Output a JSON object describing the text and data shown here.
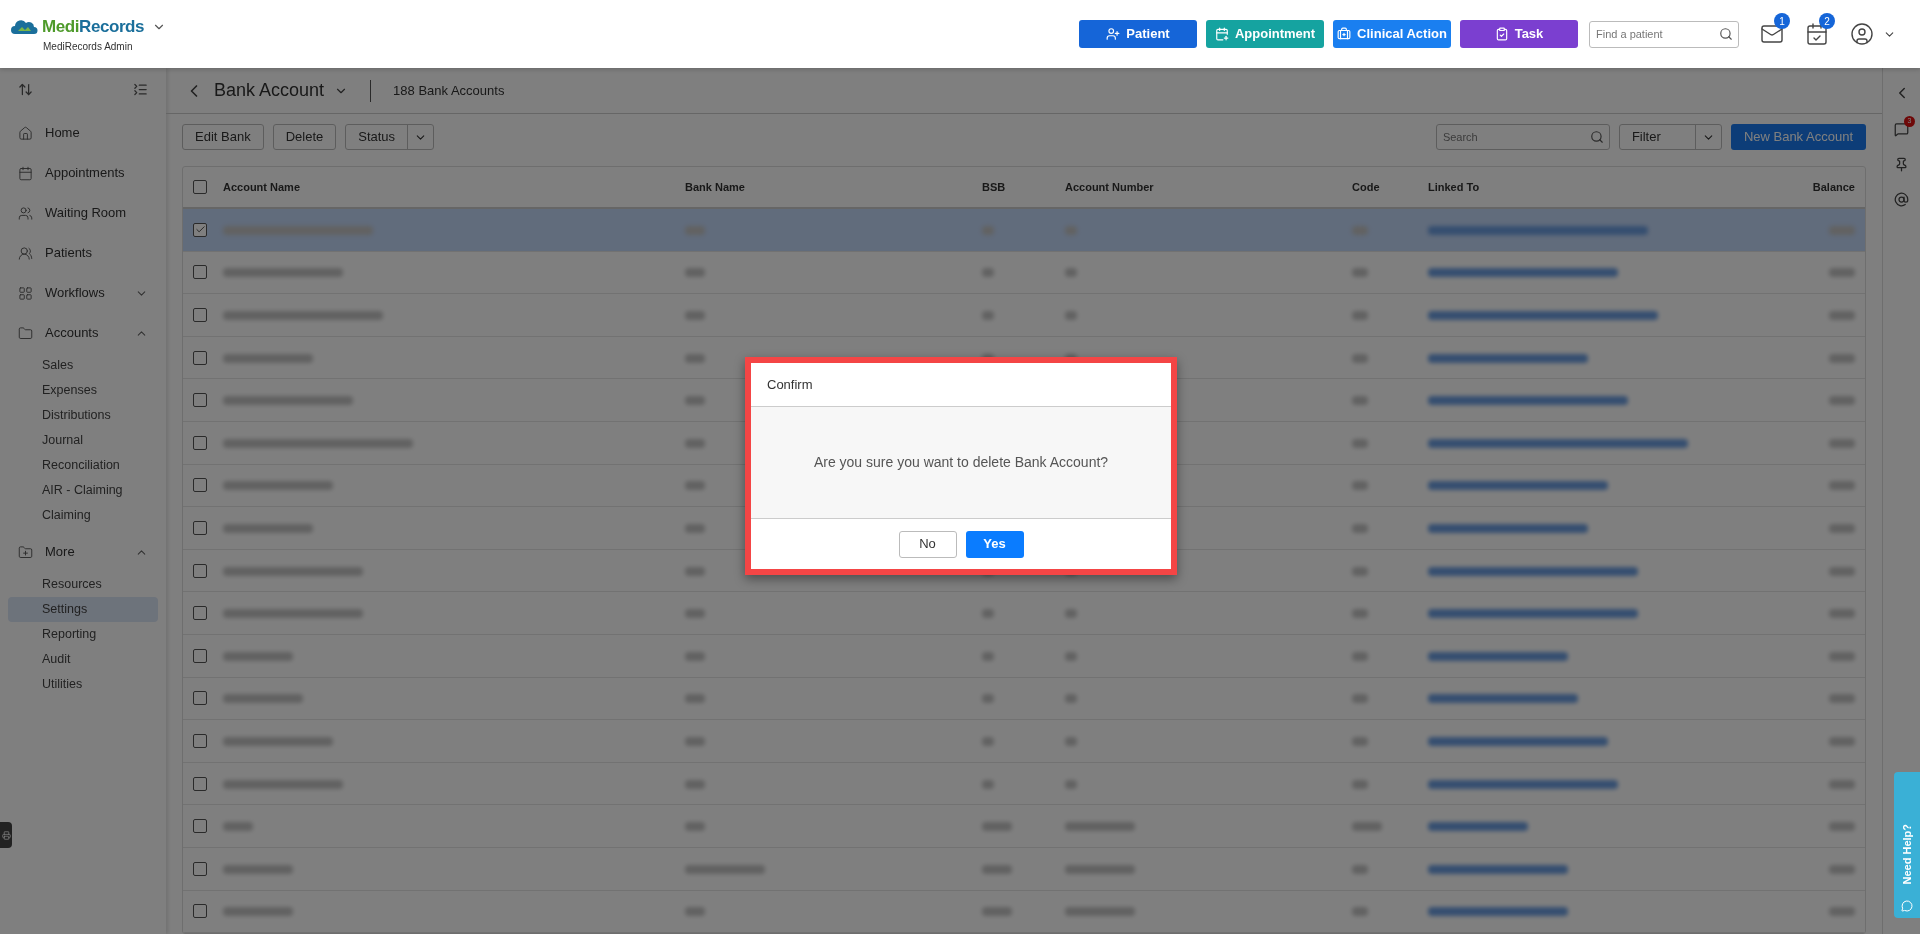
{
  "brand": {
    "name_part_1": "Medi",
    "name_part_2": "Records",
    "subtitle": "MediRecords Admin"
  },
  "top_actions": [
    {
      "label": "Patient",
      "color": "#1565d8"
    },
    {
      "label": "Appointment",
      "color": "#15a3a0"
    },
    {
      "label": "Clinical Action",
      "color": "#1a7ff0"
    },
    {
      "label": "Task",
      "color": "#7b3fd0"
    }
  ],
  "patient_search": {
    "placeholder": "Find a patient"
  },
  "notifications": {
    "mail_count": "1",
    "calendar_count": "2"
  },
  "sidebar": {
    "items": [
      {
        "label": "Home",
        "selected": false
      },
      {
        "label": "Appointments",
        "selected": false
      },
      {
        "label": "Waiting Room",
        "selected": false
      },
      {
        "label": "Patients",
        "selected": false
      },
      {
        "label": "Workflows",
        "selected": false,
        "expanded": false
      },
      {
        "label": "Accounts",
        "selected": false,
        "expanded": true,
        "children": [
          {
            "label": "Sales",
            "selected": false
          },
          {
            "label": "Expenses",
            "selected": false
          },
          {
            "label": "Distributions",
            "selected": false
          },
          {
            "label": "Journal",
            "selected": false
          },
          {
            "label": "Reconciliation",
            "selected": false
          },
          {
            "label": "AIR - Claiming",
            "selected": false
          },
          {
            "label": "Claiming",
            "selected": false
          }
        ]
      },
      {
        "label": "More",
        "selected": false,
        "expanded": true,
        "children": [
          {
            "label": "Resources",
            "selected": false
          },
          {
            "label": "Settings",
            "selected": true
          },
          {
            "label": "Reporting",
            "selected": false
          },
          {
            "label": "Audit",
            "selected": false
          },
          {
            "label": "Utilities",
            "selected": false
          }
        ]
      }
    ]
  },
  "page": {
    "title": "Bank Account",
    "count": "188 Bank Accounts"
  },
  "toolbar": {
    "buttons": [
      "Edit Bank",
      "Delete"
    ],
    "status_label": "Status",
    "search_placeholder": "Search",
    "filter_label": "Filter",
    "new_button": "New Bank Account"
  },
  "table": {
    "all_selected": false,
    "columns": [
      "Account Name",
      "Bank Name",
      "BSB",
      "Account Number",
      "Code",
      "Linked To",
      "Balance"
    ],
    "rows": [
      {
        "selected": true
      },
      {
        "selected": false
      },
      {
        "selected": false
      },
      {
        "selected": false
      },
      {
        "selected": false
      },
      {
        "selected": false
      },
      {
        "selected": false
      },
      {
        "selected": false
      },
      {
        "selected": false
      },
      {
        "selected": false
      },
      {
        "selected": false
      },
      {
        "selected": false
      },
      {
        "selected": false
      },
      {
        "selected": false
      },
      {
        "selected": false
      },
      {
        "selected": false
      },
      {
        "selected": false
      }
    ]
  },
  "right_rail": {
    "chat_count": "3"
  },
  "help_tab": {
    "label": "Need Help?"
  },
  "dialog": {
    "title": "Confirm",
    "message": "Are you sure you want to delete Bank Account?",
    "buttons": [
      {
        "label": "No",
        "kind": "secondary"
      },
      {
        "label": "Yes",
        "kind": "primary"
      }
    ]
  }
}
